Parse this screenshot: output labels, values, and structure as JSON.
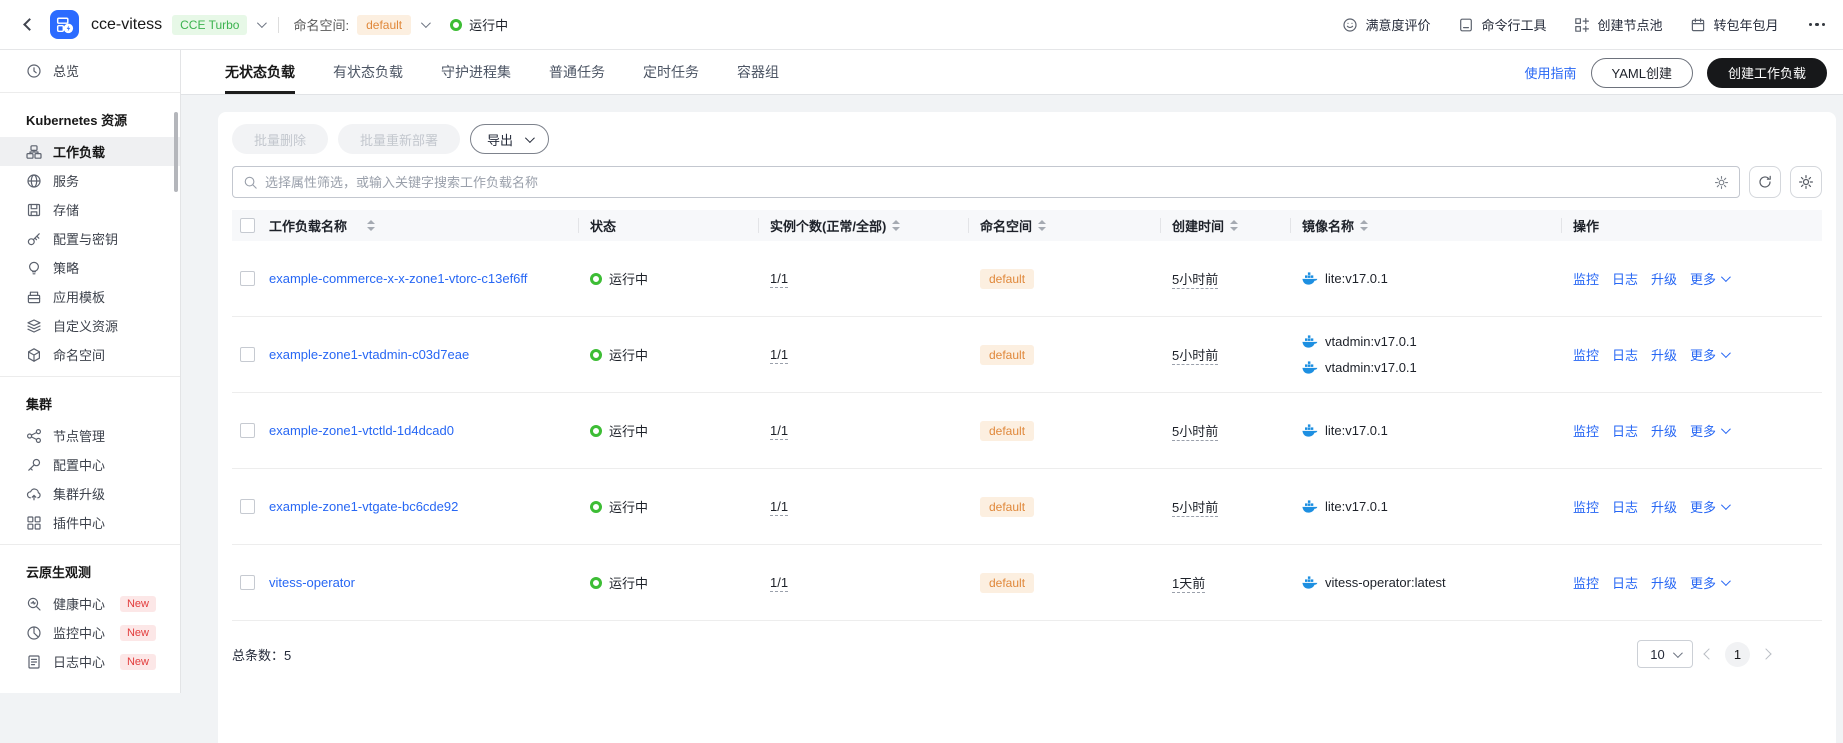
{
  "topbar": {
    "cluster_name": "cce-vitess",
    "cluster_badge": "CCE Turbo",
    "namespace_label": "命名空间:",
    "namespace_value": "default",
    "cluster_status": "运行中",
    "right_actions": [
      {
        "label": "满意度评价",
        "icon": "smiley-icon"
      },
      {
        "label": "命令行工具",
        "icon": "terminal-icon"
      },
      {
        "label": "创建节点池",
        "icon": "nodepool-icon"
      },
      {
        "label": "转包年包月",
        "icon": "calendar-icon"
      }
    ]
  },
  "sidebar": {
    "overview_label": "总览",
    "sections": [
      {
        "title": "Kubernetes 资源",
        "items": [
          {
            "label": "工作负载"
          },
          {
            "label": "服务"
          },
          {
            "label": "存储"
          },
          {
            "label": "配置与密钥"
          },
          {
            "label": "策略"
          },
          {
            "label": "应用模板"
          },
          {
            "label": "自定义资源"
          },
          {
            "label": "命名空间"
          }
        ]
      },
      {
        "title": "集群",
        "items": [
          {
            "label": "节点管理"
          },
          {
            "label": "配置中心"
          },
          {
            "label": "集群升级"
          },
          {
            "label": "插件中心"
          }
        ]
      },
      {
        "title": "云原生观测",
        "items": [
          {
            "label": "健康中心",
            "badge": "New"
          },
          {
            "label": "监控中心",
            "badge": "New"
          },
          {
            "label": "日志中心",
            "badge": "New"
          }
        ]
      }
    ]
  },
  "tabs": {
    "items": [
      "无状态负载",
      "有状态负载",
      "守护进程集",
      "普通任务",
      "定时任务",
      "容器组"
    ],
    "active": "无状态负载",
    "guide_link": "使用指南",
    "yaml_button": "YAML创建",
    "create_button": "创建工作负载"
  },
  "toolbar": {
    "batch_delete": "批量删除",
    "batch_redeploy": "批量重新部署",
    "export": "导出"
  },
  "search": {
    "placeholder": "选择属性筛选，或输入关键字搜索工作负载名称"
  },
  "table": {
    "columns": [
      "工作负载名称",
      "状态",
      "实例个数(正常/全部)",
      "命名空间",
      "创建时间",
      "镜像名称",
      "操作"
    ],
    "row_actions": [
      "监控",
      "日志",
      "升级",
      "更多"
    ],
    "rows": [
      {
        "name": "example-commerce-x-x-zone1-vtorc-c13ef6ff",
        "status": "运行中",
        "instances": "1/1",
        "namespace": "default",
        "created": "5小时前",
        "images": [
          "lite:v17.0.1"
        ]
      },
      {
        "name": "example-zone1-vtadmin-c03d7eae",
        "status": "运行中",
        "instances": "1/1",
        "namespace": "default",
        "created": "5小时前",
        "images": [
          "vtadmin:v17.0.1",
          "vtadmin:v17.0.1"
        ]
      },
      {
        "name": "example-zone1-vtctld-1d4dcad0",
        "status": "运行中",
        "instances": "1/1",
        "namespace": "default",
        "created": "5小时前",
        "images": [
          "lite:v17.0.1"
        ]
      },
      {
        "name": "example-zone1-vtgate-bc6cde92",
        "status": "运行中",
        "instances": "1/1",
        "namespace": "default",
        "created": "5小时前",
        "images": [
          "lite:v17.0.1"
        ]
      },
      {
        "name": "vitess-operator",
        "status": "运行中",
        "instances": "1/1",
        "namespace": "default",
        "created": "1天前",
        "images": [
          "vitess-operator:latest"
        ]
      }
    ]
  },
  "footer": {
    "total_label": "总条数：",
    "total_value": "5",
    "page_size": "10",
    "current_page": "1"
  },
  "colors": {
    "link_blue": "#2767f4",
    "status_green": "#3dbd35",
    "namespace_orange": "#e0883a",
    "cce_turbo_green": "#3cb34f",
    "new_badge_red": "#e23c3c",
    "brand_blue": "#2b6bff",
    "docker_blue": "#1d8fe1"
  }
}
